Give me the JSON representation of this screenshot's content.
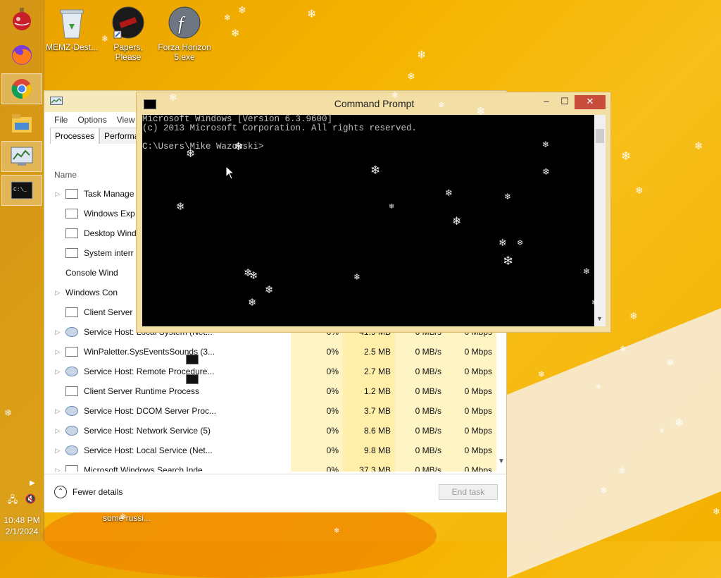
{
  "desktop": {
    "icons": [
      {
        "label": "MEMZ-Dest...",
        "icon": "recycle-bin-icon"
      },
      {
        "label": "Papers, Please",
        "icon": "papers-please-icon"
      },
      {
        "label": "Forza Horizon 5.exe",
        "icon": "flash-icon"
      }
    ],
    "bottom_label": "some russi..."
  },
  "taskbar": {
    "pinned": [
      "ornament-icon",
      "firefox-icon",
      "chrome-icon",
      "file-explorer-icon",
      "task-manager-icon",
      "command-prompt-icon"
    ],
    "clock": "10:48 PM",
    "date": "2/1/2024"
  },
  "task_manager": {
    "menu": [
      "File",
      "Options",
      "View"
    ],
    "tabs": [
      "Processes",
      "Performan"
    ],
    "column_name": "Name",
    "rows": [
      {
        "name": "Task Manage",
        "expand": true,
        "icon": "tm",
        "cpu": "",
        "mem": "",
        "disk": "",
        "net": ""
      },
      {
        "name": "Windows Exp",
        "expand": false,
        "icon": "folder",
        "cpu": "",
        "mem": "",
        "disk": "",
        "net": ""
      },
      {
        "name": "Desktop Wind",
        "expand": false,
        "icon": "win",
        "cpu": "",
        "mem": "",
        "disk": "",
        "net": ""
      },
      {
        "name": "System interr",
        "expand": false,
        "icon": "win",
        "cpu": "",
        "mem": "",
        "disk": "",
        "net": ""
      },
      {
        "name": "Console Wind",
        "expand": false,
        "icon": "cmd",
        "cpu": "",
        "mem": "",
        "disk": "",
        "net": ""
      },
      {
        "name": "Windows Con",
        "expand": true,
        "icon": "cmd",
        "cpu": "",
        "mem": "",
        "disk": "",
        "net": ""
      },
      {
        "name": "Client Server",
        "expand": false,
        "icon": "win",
        "cpu": "",
        "mem": "",
        "disk": "",
        "net": ""
      },
      {
        "name": "Service Host: Local System (Net...",
        "expand": true,
        "icon": "gear",
        "cpu": "0%",
        "mem": "41.9 MB",
        "disk": "0 MB/s",
        "net": "0 Mbps"
      },
      {
        "name": "WinPaletter.SysEventsSounds (3...",
        "expand": true,
        "icon": "win",
        "cpu": "0%",
        "mem": "2.5 MB",
        "disk": "0 MB/s",
        "net": "0 Mbps"
      },
      {
        "name": "Service Host: Remote Procedure...",
        "expand": true,
        "icon": "gear",
        "cpu": "0%",
        "mem": "2.7 MB",
        "disk": "0 MB/s",
        "net": "0 Mbps"
      },
      {
        "name": "Client Server Runtime Process",
        "expand": false,
        "icon": "win",
        "cpu": "0%",
        "mem": "1.2 MB",
        "disk": "0 MB/s",
        "net": "0 Mbps"
      },
      {
        "name": "Service Host: DCOM Server Proc...",
        "expand": true,
        "icon": "gear",
        "cpu": "0%",
        "mem": "3.7 MB",
        "disk": "0 MB/s",
        "net": "0 Mbps"
      },
      {
        "name": "Service Host: Network Service (5)",
        "expand": true,
        "icon": "gear",
        "cpu": "0%",
        "mem": "8.6 MB",
        "disk": "0 MB/s",
        "net": "0 Mbps"
      },
      {
        "name": "Service Host: Local Service (Net...",
        "expand": true,
        "icon": "gear",
        "cpu": "0%",
        "mem": "9.8 MB",
        "disk": "0 MB/s",
        "net": "0 Mbps"
      },
      {
        "name": "Microsoft Windows Search Inde...",
        "expand": true,
        "icon": "search",
        "cpu": "0%",
        "mem": "37.3 MB",
        "disk": "0 MB/s",
        "net": "0 Mbps"
      }
    ],
    "fewer_details": "Fewer details",
    "end_task": "End task"
  },
  "command_prompt": {
    "title": "Command Prompt",
    "minimize": "–",
    "maximize": "☐",
    "close": "✕",
    "lines": [
      "Microsoft Windows [Version 6.3.9600]",
      "(c) 2013 Microsoft Corporation. All rights reserved.",
      "",
      "C:\\Users\\Mike Wazowski>"
    ]
  },
  "colors": {
    "cmd_close": "#c74c3c",
    "window_frame": "#f3dfa5",
    "wallpaper": "#f5b400"
  }
}
